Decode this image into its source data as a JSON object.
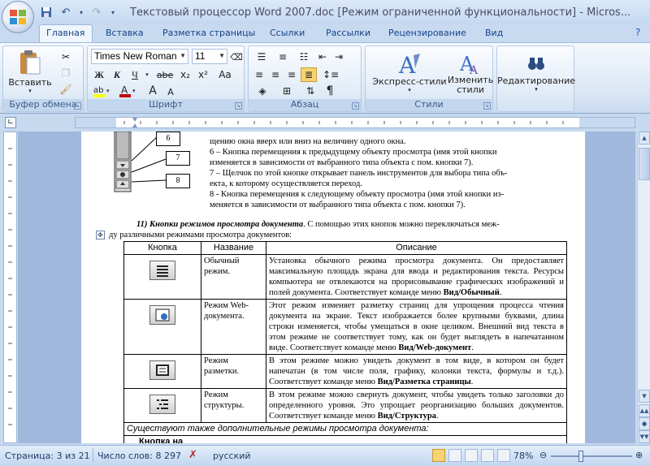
{
  "window": {
    "title": "Текстовый процессор Word 2007.doc [Режим ограниченной функциональности] - Micros..."
  },
  "colors": {
    "accent": "#15428b",
    "ribbon_bg": "#dbe7f5",
    "doc_bg": "#9fb8dc"
  },
  "tabs": [
    "Главная",
    "Вставка",
    "Разметка страницы",
    "Ссылки",
    "Рассылки",
    "Рецензирование",
    "Вид"
  ],
  "ribbon": {
    "clipboard": {
      "label": "Буфер обмена",
      "paste": "Вставить"
    },
    "font": {
      "label": "Шрифт",
      "font_name": "Times New Roman",
      "font_size": "11",
      "bold": "Ж",
      "italic": "К",
      "underline": "Ч",
      "strike": "abe",
      "sub": "x₂",
      "sup": "x²",
      "grow": "A",
      "shrink": "A",
      "case": "Aa"
    },
    "paragraph": {
      "label": "Абзац",
      "pilcrow": "¶"
    },
    "styles": {
      "label": "Стили",
      "express": "Экспресс-стили",
      "change_1": "Изменить",
      "change_2": "стили"
    },
    "editing": {
      "label": "Редактирование"
    }
  },
  "document": {
    "callouts": [
      "6",
      "7",
      "8"
    ],
    "top_lines": [
      "щению окна вверх или вниз на величину одного окна.",
      "6 – Кнопка перемещения к предыдущему объекту просмотра (имя этой кнопки",
      "изменяется в зависимости от выбранного типа объекта с пом. кнопки 7).",
      "7 – Щелчок по этой кнопке открывает панель инструментов для выбора типа объ-",
      "екта, к которому осуществляется переход.",
      "8 - Кнопка перемещения к следующему объекту просмотра (имя этой кнопки из-",
      "меняется в зависимости от выбранного типа объекта с пом. кнопки 7)."
    ],
    "section_heading": "11) Кнопки режимов просмотра документа",
    "section_text_1": ". С помощью этих кнопок можно переключаться меж-",
    "section_text_2": "ду различными режимами просмотра документов:",
    "table": {
      "headers": [
        "Кнопка",
        "Название",
        "Описание"
      ],
      "rows": [
        {
          "icon": "normal-view-icon",
          "name": "Обычный режим.",
          "desc": "Установка обычного режима просмотра документа. Он предоставляет максимальную площадь экрана для ввода и редактирования текста. Ресурсы компьютера не отвлекаются на прорисовывание графических изображений и полей документа. Соответствует команде меню ",
          "cmd": "Вид/Обычный",
          "end": "."
        },
        {
          "icon": "web-view-icon",
          "name": "Режим Web-документа.",
          "desc": "Этот режим изменяет разметку страниц для упрощения процесса чтения документа на экране. Текст изображается более крупными буквами, длина строки изменяется, чтобы умещаться в окне целиком. Внешний вид текста в этом режиме не соответствует тому, как он будет выглядеть в напечатанном виде. Соответствует команде меню ",
          "cmd": "Вид/Web-документ",
          "end": "."
        },
        {
          "icon": "layout-view-icon",
          "name": "Режим разметки.",
          "desc": "В этом режиме можно увидеть документ в том виде, в котором он будет напечатан (в том числе поля, графику, колонки текста, формулы и т.д.). Соответствует команде меню ",
          "cmd": "Вид/Разметка страницы",
          "end": "."
        },
        {
          "icon": "outline-view-icon",
          "name": "Режим структуры.",
          "desc": "В этом режиме можно свернуть документ, чтобы увидеть только заголовки до определенного уровня. Это упрощает реорганизацию больших документов. Соответствует команде меню ",
          "cmd": "Вид/Структура",
          "end": "."
        }
      ],
      "footer": "Существуют также дополнительные режимы просмотра документа:",
      "footer_cell": "Кнопка на"
    }
  },
  "status": {
    "page": "Страница: 3 из 21",
    "words": "Число слов: 8 297",
    "language": "русский",
    "zoom": "78%"
  }
}
